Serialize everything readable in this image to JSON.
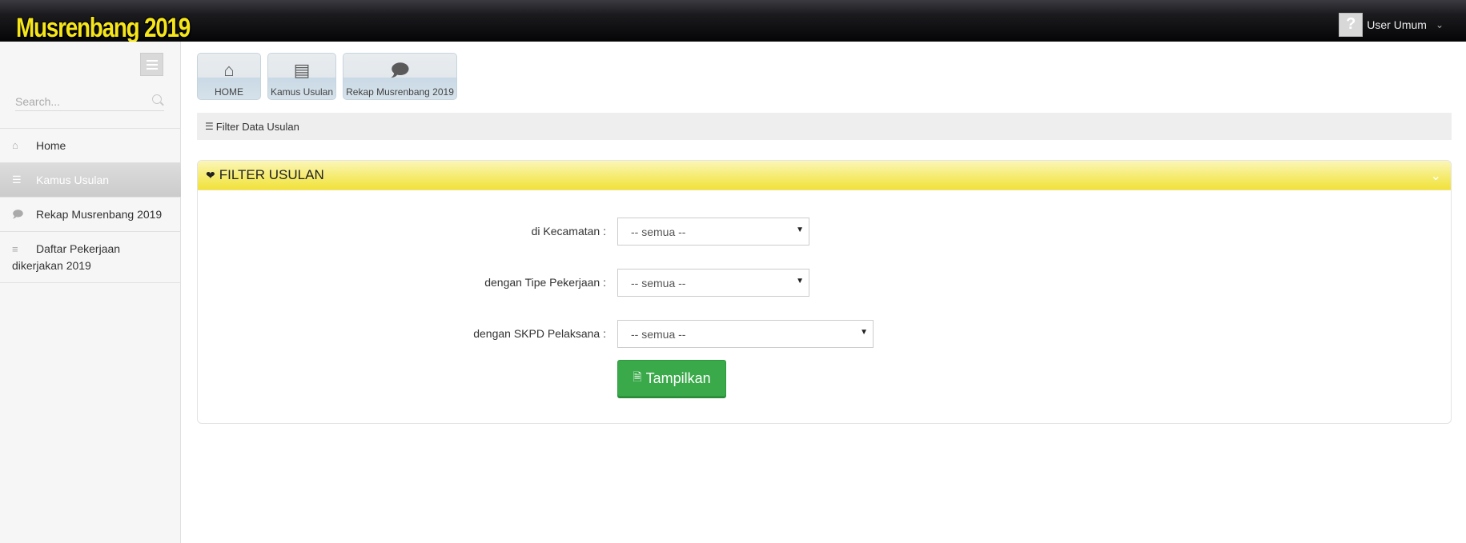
{
  "app": {
    "title": "Musrenbang 2019"
  },
  "user": {
    "name": "User Umum",
    "avatar_icon": "question-mark-icon"
  },
  "sidebar": {
    "search_placeholder": "Search...",
    "items": [
      {
        "label": "Home",
        "icon": "home-icon",
        "active": false
      },
      {
        "label": "Kamus Usulan",
        "icon": "list-icon",
        "active": true
      },
      {
        "label": "Rekap Musrenbang 2019",
        "icon": "comments-icon",
        "active": false
      },
      {
        "label": "Daftar Pekerjaan dikerjakan 2019",
        "icon": "list-bullets-icon",
        "active": false
      }
    ]
  },
  "shortcuts": [
    {
      "label": "HOME",
      "icon": "home-icon"
    },
    {
      "label": "Kamus Usulan",
      "icon": "server-icon"
    },
    {
      "label": "Rekap Musrenbang 2019",
      "icon": "comments-icon"
    }
  ],
  "breadcrumb": {
    "label": "Filter Data Usulan"
  },
  "panel": {
    "title": "FILTER USULAN",
    "fields": [
      {
        "label": "di Kecamatan :",
        "value": "-- semua --"
      },
      {
        "label": "dengan Tipe Pekerjaan :",
        "value": "-- semua --"
      },
      {
        "label": "dengan SKPD Pelaksana :",
        "value": "-- semua --"
      }
    ],
    "submit_label": "Tampilkan"
  }
}
